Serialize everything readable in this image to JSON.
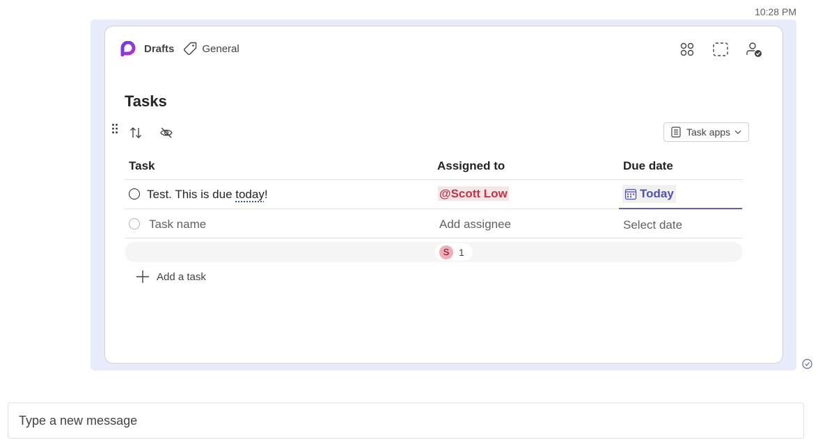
{
  "message": {
    "timestamp": "10:28 PM"
  },
  "loop": {
    "workspace": "Drafts",
    "channel": "General",
    "header_icons": [
      "apps-grid-icon",
      "expand-icon",
      "shared-people-icon"
    ]
  },
  "tasks": {
    "title": "Tasks",
    "task_apps_label": "Task apps",
    "columns": {
      "task": "Task",
      "assigned": "Assigned to",
      "due": "Due date"
    },
    "row": {
      "text_before": "Test. This is due ",
      "text_squiggle": "today",
      "text_after": "!",
      "assignee": "@Scott Low",
      "due": "Today"
    },
    "new_row": {
      "task_placeholder": "Task name",
      "assignee_placeholder": "Add assignee",
      "date_placeholder": "Select date"
    },
    "group": {
      "avatar_initial": "S",
      "count": "1"
    },
    "add_task_label": "Add a task"
  },
  "composer": {
    "placeholder": "Type a new message"
  }
}
